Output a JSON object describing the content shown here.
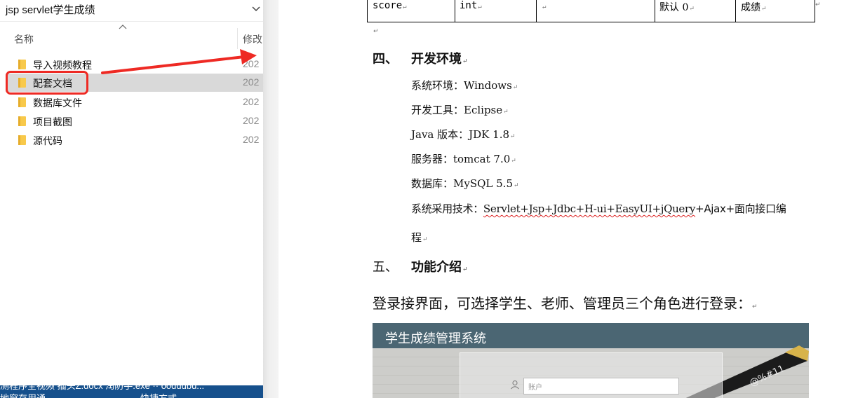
{
  "explorer": {
    "title": "jsp servlet学生成绩",
    "col_name": "名称",
    "col_modified": "修改",
    "items": [
      {
        "name": "导入视频教程",
        "date": "202"
      },
      {
        "name": "配套文档",
        "date": "202",
        "selected": true
      },
      {
        "name": "数据库文件",
        "date": "202"
      },
      {
        "name": "项目截图",
        "date": "202"
      },
      {
        "name": "源代码",
        "date": "202"
      }
    ],
    "taskbar": {
      "line1": "测程序全视频  插头Z.docx  淘防手.exe  ··  ooddubu...",
      "line2": "地窗存用通",
      "line3": "快捷方式"
    }
  },
  "colors": {
    "highlight": "#ee2a24",
    "selection": "#d9d9d9",
    "folder": "#f8c94b",
    "login_header": "#4b6673"
  },
  "doc": {
    "table_row": {
      "c1": "score",
      "c2": "int",
      "c3": "",
      "c4": "默认 0",
      "c5": "成绩"
    },
    "para_mark": "↵",
    "section4": {
      "num": "四、",
      "title": "开发环境"
    },
    "env": [
      "系统环境：Windows",
      "开发工具：Eclipse",
      "Java 版本：JDK 1.8",
      "服务器：tomcat 7.0",
      "数据库：MySQL 5.5"
    ],
    "tech_prefix": "系统采用技术：",
    "tech_underlined": "Servlet+Jsp+Jdbc+H-ui+EasyUI+jQuery",
    "tech_suffix": "+Ajax+面向接口编",
    "tech_wrap": "程",
    "section5": {
      "num": "五、",
      "title": "功能介绍"
    },
    "login_desc": "登录接界面，可选择学生、老师、管理员三个角色进行登录：",
    "login_preview": {
      "title": "学生成绩管理系统",
      "account_placeholder": "账户",
      "pen_text": "@%#11"
    }
  }
}
